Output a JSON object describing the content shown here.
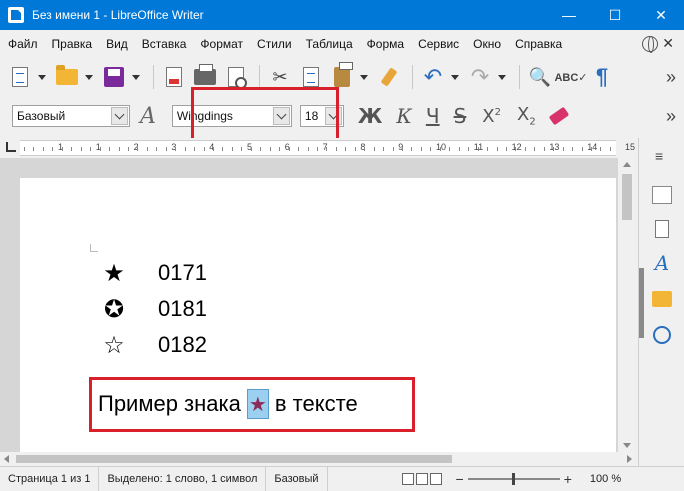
{
  "window": {
    "title": "Без имени 1 - LibreOffice Writer",
    "minimize": "—",
    "maximize": "☐",
    "close": "✕"
  },
  "menu": {
    "items": [
      "Файл",
      "Правка",
      "Вид",
      "Вставка",
      "Формат",
      "Стили",
      "Таблица",
      "Форма",
      "Сервис",
      "Окно",
      "Справка"
    ],
    "close_doc": "✕"
  },
  "toolbar1": {
    "more": "»"
  },
  "toolbar2": {
    "paragraph_style": "Базовый",
    "font_name": "Wingdings",
    "font_size": "18",
    "bold": "Ж",
    "italic": "К",
    "underline": "Ч",
    "strike": "S",
    "superscript_base": "X",
    "superscript_mark": "2",
    "subscript_base": "X",
    "subscript_mark": "2",
    "more": "»"
  },
  "ruler": {
    "labels": [
      "1",
      "1",
      "2",
      "3",
      "4",
      "5",
      "6",
      "7",
      "8",
      "9",
      "10",
      "11",
      "12",
      "13",
      "14",
      "15"
    ]
  },
  "document": {
    "symbols": [
      {
        "glyph": "★",
        "code": "0171"
      },
      {
        "glyph": "✪",
        "code": "0181"
      },
      {
        "glyph": "☆",
        "code": "0182"
      }
    ],
    "sample_before": "Пример знака",
    "sample_symbol": "★",
    "sample_after": "в тексте"
  },
  "statusbar": {
    "page": "Страница 1 из 1",
    "selection": "Выделено: 1 слово, 1 символ",
    "style": "Базовый",
    "zoom_minus": "−",
    "zoom_plus": "+",
    "zoom": "100 %"
  },
  "colors": {
    "titlebar": "#0078d7",
    "highlight_frame": "#d9202a",
    "selection": "#9bd0f0",
    "star_color": "#8b2b57"
  }
}
